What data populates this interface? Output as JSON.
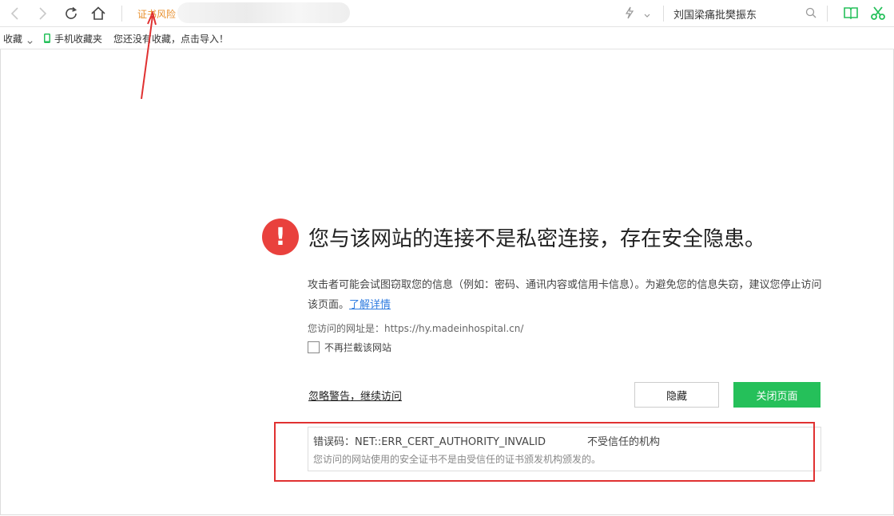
{
  "toolbar": {
    "cert_risk_label": "证书风险",
    "search_text": "刘国梁痛批樊振东"
  },
  "bookmarks": {
    "favorites_label": "收藏",
    "mobile_favorites_label": "手机收藏夹",
    "import_hint": "您还没有收藏，点击导入！"
  },
  "warning": {
    "headline": "您与该网站的连接不是私密连接，存在安全隐患。",
    "description": "攻击者可能会试图窃取您的信息（例如：密码、通讯内容或信用卡信息）。为避免您的信息失窃，建议您停止访问该页面。",
    "learn_more": "了解详情",
    "url_line": "您访问的网址是：https://hy.madeinhospital.cn/",
    "dont_block_label": "不再拦截该网站",
    "ignore_link": "忽略警告，继续访问",
    "hide_button": "隐藏",
    "close_button": "关闭页面",
    "error_code": "错误码：NET::ERR_CERT_AUTHORITY_INVALID",
    "error_reason": "不受信任的机构",
    "error_detail": "您访问的网站使用的安全证书不是由受信任的证书颁发机构颁发的。"
  },
  "colors": {
    "accent_green": "#25c05a",
    "error_red": "#e9413d",
    "cert_orange": "#e8912f",
    "annotation_red": "#e03131"
  }
}
